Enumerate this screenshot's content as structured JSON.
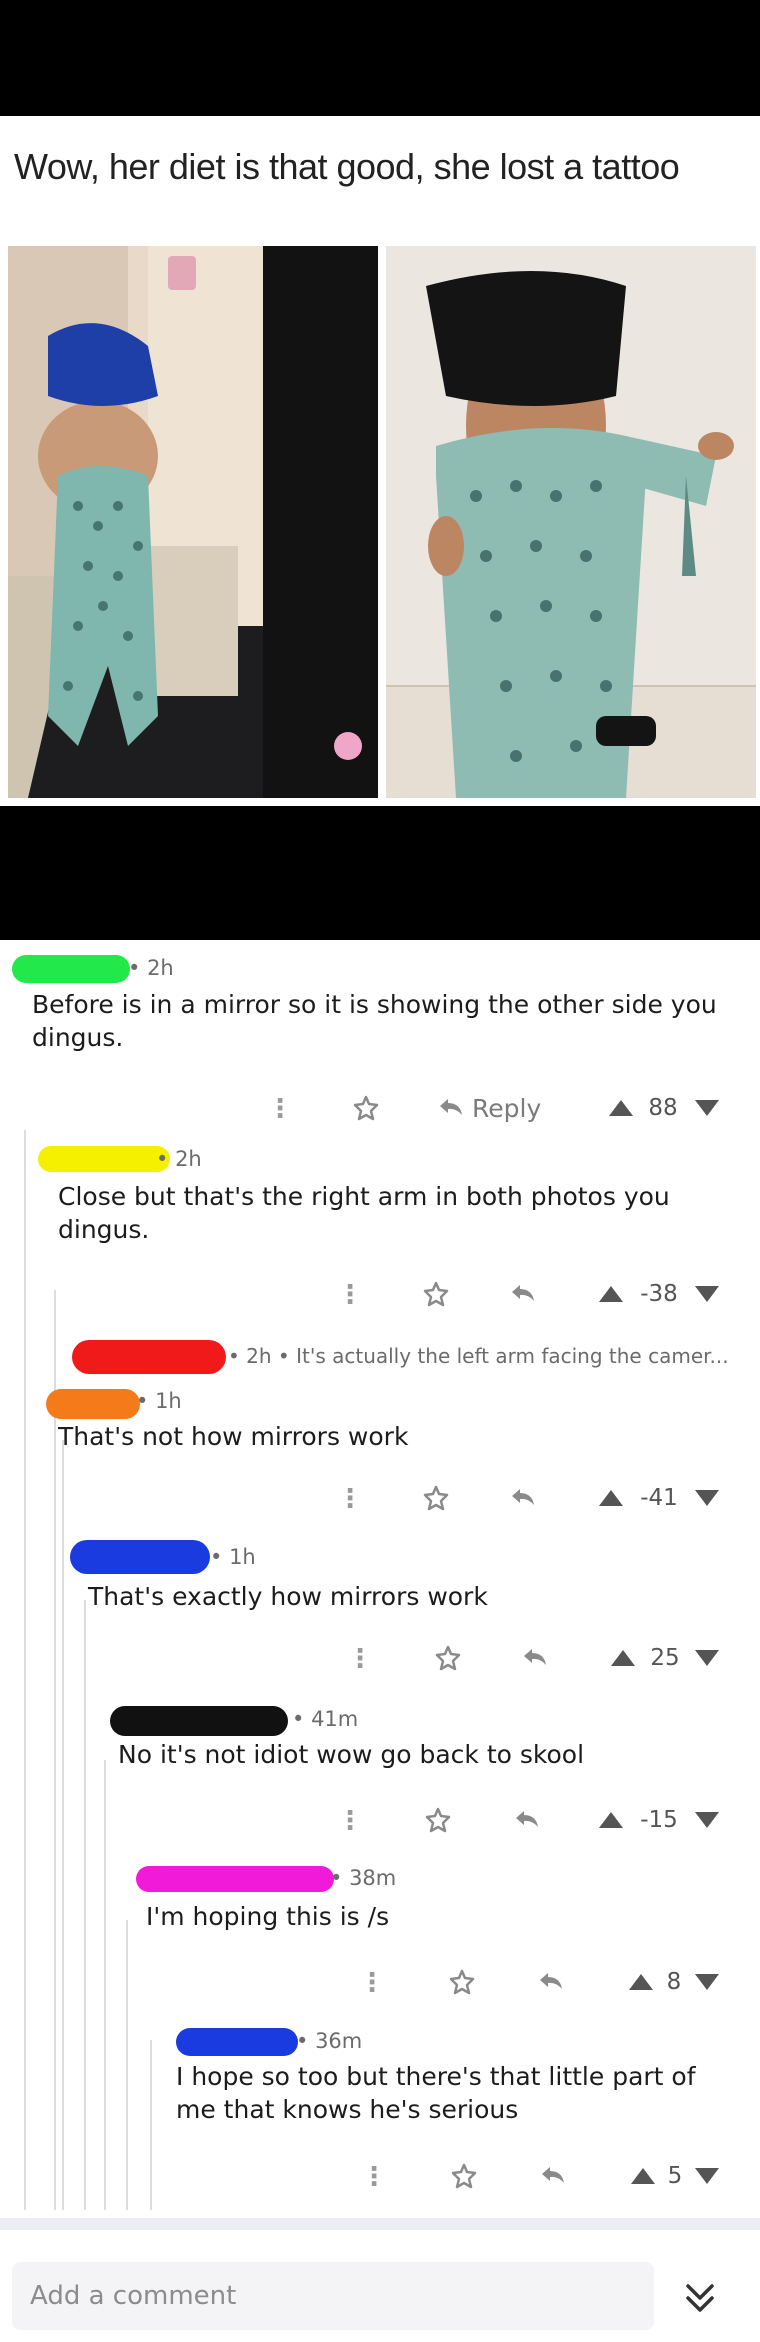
{
  "meme": {
    "title": "Wow, her diet is that good, she lost a tattoo"
  },
  "comments": [
    {
      "time": "2h",
      "text": "Before is in a mirror so it is showing the other side you dingus.",
      "score": "88",
      "reply_label": "Reply",
      "redact_color": "#22e84a"
    },
    {
      "time": "2h",
      "text": "Close but that's the right arm in both photos you dingus.",
      "score": "-38",
      "redact_color": "#f5f000"
    },
    {
      "time": "2h",
      "text": "It's actually the left arm facing the camer...",
      "redact_color": "#f01a1a",
      "collapsed": true
    },
    {
      "time": "1h",
      "text": "That's not how mirrors work",
      "score": "-41",
      "redact_color": "#f57a1a"
    },
    {
      "time": "1h",
      "text": "That's exactly how mirrors work",
      "score": "25",
      "redact_color": "#1a3be0"
    },
    {
      "time": "41m",
      "text": "No it's not idiot wow go back to skool",
      "score": "-15",
      "redact_color": "#111111"
    },
    {
      "time": "38m",
      "text": "I'm hoping this is /s",
      "score": "8",
      "redact_color": "#f01ad8"
    },
    {
      "time": "36m",
      "text": "I hope so too but there's that little part of me that knows he's serious",
      "score": "5",
      "redact_color": "#1a3be0"
    }
  ],
  "composer": {
    "placeholder": "Add a comment"
  },
  "icons": {
    "more": "more-vertical-icon",
    "award": "award-icon",
    "reply": "reply-arrow-icon",
    "upvote": "upvote-icon",
    "downvote": "downvote-icon",
    "expand": "double-chevron-down-icon"
  }
}
